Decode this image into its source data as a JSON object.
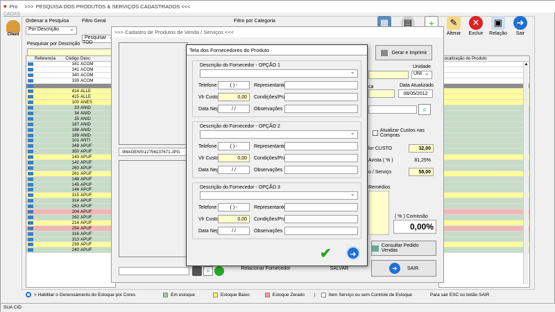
{
  "main": {
    "title": "PESQUISA DOS PRODUTOS & SERVIÇOS CADASTRADOS  <<<",
    "title_prefix": ">>>",
    "app_label": "Pro",
    "menu_cadastro": "CADAS",
    "client_label": "Client",
    "ordenar_label": "Ordenar a Pesquisa",
    "ordenar_value": "Por Descrição",
    "filtro_geral_label": "Filtro Geral",
    "filtro_geral_value": "Pesquisar TOD",
    "filtro_categoria_label": "Filtro por Categoria",
    "pesquisar_label": "Pesquisar por Descrição",
    "grid": {
      "headers": [
        "Referencia",
        "Código",
        "Desc",
        "Localização do Produto"
      ],
      "rows": [
        {
          "code": "341",
          "desc": "ACOM",
          "color": "white"
        },
        {
          "code": "341",
          "desc": "ACOM",
          "color": "white"
        },
        {
          "code": "340",
          "desc": "ACOM",
          "color": "white"
        },
        {
          "code": "339",
          "desc": "ACOM",
          "color": "white"
        },
        {
          "code": "",
          "desc": "",
          "color": "gray"
        },
        {
          "code": "414",
          "desc": "ALLE",
          "color": "yellow"
        },
        {
          "code": "415",
          "desc": "ALLE",
          "color": "yellow"
        },
        {
          "code": "100",
          "desc": "ANES",
          "color": "yellow"
        },
        {
          "code": "33",
          "desc": "ANID",
          "color": "green"
        },
        {
          "code": "34",
          "desc": "ANID",
          "color": "green"
        },
        {
          "code": "35",
          "desc": "ANID",
          "color": "green"
        },
        {
          "code": "187",
          "desc": "ANID",
          "color": "green"
        },
        {
          "code": "188",
          "desc": "ANID",
          "color": "green"
        },
        {
          "code": "189",
          "desc": "ANID",
          "color": "green"
        },
        {
          "code": "101",
          "desc": "ANTI",
          "color": "green"
        },
        {
          "code": "349",
          "desc": "APUF",
          "color": "green"
        },
        {
          "code": "350",
          "desc": "APUF",
          "color": "green"
        },
        {
          "code": "143",
          "desc": "APUF",
          "color": "yellow"
        },
        {
          "code": "142",
          "desc": "APUF",
          "color": "green"
        },
        {
          "code": "260",
          "desc": "APUF",
          "color": "green"
        },
        {
          "code": "261",
          "desc": "APUF",
          "color": "yellow"
        },
        {
          "code": "148",
          "desc": "APUF",
          "color": "green"
        },
        {
          "code": "145",
          "desc": "APUF",
          "color": "green"
        },
        {
          "code": "144",
          "desc": "APUF",
          "color": "green"
        },
        {
          "code": "315",
          "desc": "APUF",
          "color": "yellow"
        },
        {
          "code": "314",
          "desc": "APUF",
          "color": "green"
        },
        {
          "code": "263",
          "desc": "APUF",
          "color": "green"
        },
        {
          "code": "204",
          "desc": "APUF",
          "color": "red"
        },
        {
          "code": "262",
          "desc": "APUF",
          "color": "green"
        },
        {
          "code": "214",
          "desc": "APUF",
          "color": "yellow"
        },
        {
          "code": "254",
          "desc": "APUF",
          "color": "red"
        },
        {
          "code": "316",
          "desc": "APUF",
          "color": "green"
        },
        {
          "code": "313",
          "desc": "APUF",
          "color": "green"
        },
        {
          "code": "239",
          "desc": "APUF",
          "color": "yellow"
        },
        {
          "code": "240",
          "desc": "APUF",
          "color": "green"
        }
      ]
    },
    "toolbar": {
      "alterar": "Alterar",
      "excluir": "Excluir",
      "relacao": "Relação",
      "sair": "Sair"
    },
    "legend": {
      "habilitar": "> Habilitar o Gerenciamento do Estoque por Cores",
      "em_estoque": "Em estoque",
      "estoque_baixo": "Estoque Baixo",
      "estoque_zerado": "Estoque Zerado",
      "separator": "|",
      "servico": "Item Serviço ou sem Controle de Estoque",
      "sair_hint": "Para sair ESC ou botão SAIR"
    },
    "status": "SUA CID"
  },
  "cadastro": {
    "title": ">>>  Cadastro de Produtos de Venda / Serviços  <<<",
    "gerar_imprimir": "Gerar e Imprimir",
    "unidade_label": "Unidade",
    "unidade_value": "UNI",
    "ca_label": "ca",
    "data_atualizado_label": "Data Atualizado",
    "data_atualizado_value": "08/05/2012",
    "atualizar_custos": "Atualizar Custos nas Compras",
    "custo_label": "lor CUSTO",
    "custo_value": "32,00",
    "avista_label": "Avista ( % )",
    "avista_value": "81,25%",
    "servico_label": "o / Serviço",
    "servico_value": "58,00",
    "remedios_label": "Remédios",
    "comissao_label": "( % ) Comissão",
    "comissao_value": "0,00%",
    "consultar_pedido": "Consultar Pedido Vendas",
    "sair": "SAIR",
    "salvar": "SALVAR",
    "relacionar": "Relacionar Fornecedor",
    "image_path": ".\\IMAGENS\\12756137671.JPG"
  },
  "fornecedores": {
    "title": "Tela dos Fornecedores do Produto",
    "labels": {
      "telefone": "Telefone",
      "representante": "Representante",
      "vlr_custo": "Vlr Custo",
      "condicoes": "Condições/Przo",
      "data_neg": "Data Neg.",
      "observacoes": "Observações"
    },
    "options": [
      {
        "heading": "Descrição do Fornecedor - OPÇÃO 1",
        "telefone": "(  )    -",
        "vlr_custo": "0,00",
        "data_neg": "/ /",
        "data_neg_label": "Data Neg."
      },
      {
        "heading": "Descrição do Fornecedor - OPÇÃO 2",
        "telefone": "(  )    -",
        "vlr_custo": "0,00",
        "data_neg": "/ /",
        "data_neg_label": "Data Neg."
      },
      {
        "heading": "Descrição do Fornecedor - OPÇÃO 3",
        "telefone": "(  )    -",
        "vlr_custo": "0,00",
        "data_neg": "/ /",
        "data_neg_label": "Data Neg."
      }
    ]
  },
  "colors": {
    "green": "#c6dcc6",
    "yellow": "#ffff99",
    "red": "#f2b6b6",
    "gray": "#8c8c8c",
    "white": "#ffffff"
  }
}
